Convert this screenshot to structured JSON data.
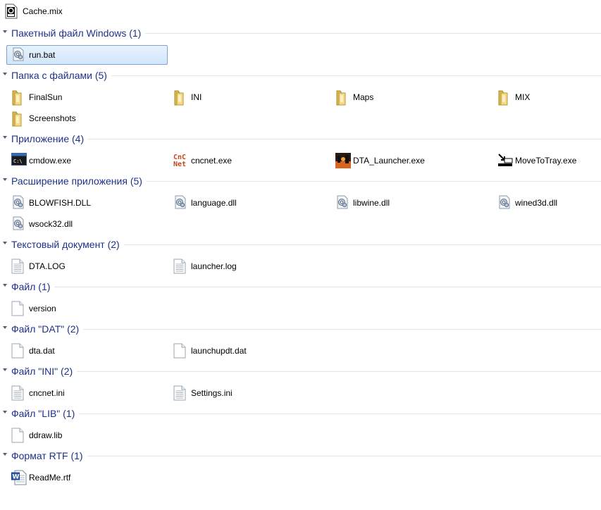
{
  "top_item": {
    "label": "Cache.mix",
    "icon": "mix-file-icon"
  },
  "groups": [
    {
      "key": "bat",
      "header": "Пакетный файл Windows (1)",
      "items": [
        {
          "label": "run.bat",
          "icon": "gear-file-icon",
          "selected": true
        }
      ]
    },
    {
      "key": "folder",
      "header": "Папка с файлами (5)",
      "items": [
        {
          "label": "FinalSun",
          "icon": "folder-icon"
        },
        {
          "label": "INI",
          "icon": "folder-icon"
        },
        {
          "label": "Maps",
          "icon": "folder-icon"
        },
        {
          "label": "MIX",
          "icon": "folder-icon"
        },
        {
          "label": "Screenshots",
          "icon": "folder-icon"
        }
      ]
    },
    {
      "key": "app",
      "header": "Приложение (4)",
      "items": [
        {
          "label": "cmdow.exe",
          "icon": "console-app-icon"
        },
        {
          "label": "cncnet.exe",
          "icon": "cncnet-app-icon"
        },
        {
          "label": "DTA_Launcher.exe",
          "icon": "launcher-app-icon"
        },
        {
          "label": "MoveToTray.exe",
          "icon": "tray-app-icon"
        }
      ]
    },
    {
      "key": "dll",
      "header": "Расширение приложения (5)",
      "items": [
        {
          "label": "BLOWFISH.DLL",
          "icon": "gear-file-icon"
        },
        {
          "label": "language.dll",
          "icon": "gear-file-icon"
        },
        {
          "label": "libwine.dll",
          "icon": "gear-file-icon"
        },
        {
          "label": "wined3d.dll",
          "icon": "gear-file-icon"
        },
        {
          "label": "wsock32.dll",
          "icon": "gear-file-icon"
        }
      ]
    },
    {
      "key": "txt",
      "header": "Текстовый документ (2)",
      "items": [
        {
          "label": "DTA.LOG",
          "icon": "text-file-icon"
        },
        {
          "label": "launcher.log",
          "icon": "text-file-icon"
        }
      ]
    },
    {
      "key": "file",
      "header": "Файл (1)",
      "items": [
        {
          "label": "version",
          "icon": "blank-file-icon"
        }
      ]
    },
    {
      "key": "dat",
      "header": "Файл \"DAT\" (2)",
      "items": [
        {
          "label": "dta.dat",
          "icon": "blank-file-icon"
        },
        {
          "label": "launchupdt.dat",
          "icon": "blank-file-icon"
        }
      ]
    },
    {
      "key": "ini",
      "header": "Файл \"INI\" (2)",
      "items": [
        {
          "label": "cncnet.ini",
          "icon": "text-file-icon"
        },
        {
          "label": "Settings.ini",
          "icon": "text-file-icon"
        }
      ]
    },
    {
      "key": "lib",
      "header": "Файл \"LIB\" (1)",
      "items": [
        {
          "label": "ddraw.lib",
          "icon": "blank-file-icon"
        }
      ]
    },
    {
      "key": "rtf",
      "header": "Формат RTF (1)",
      "items": [
        {
          "label": "ReadMe.rtf",
          "icon": "word-doc-icon"
        }
      ]
    }
  ]
}
